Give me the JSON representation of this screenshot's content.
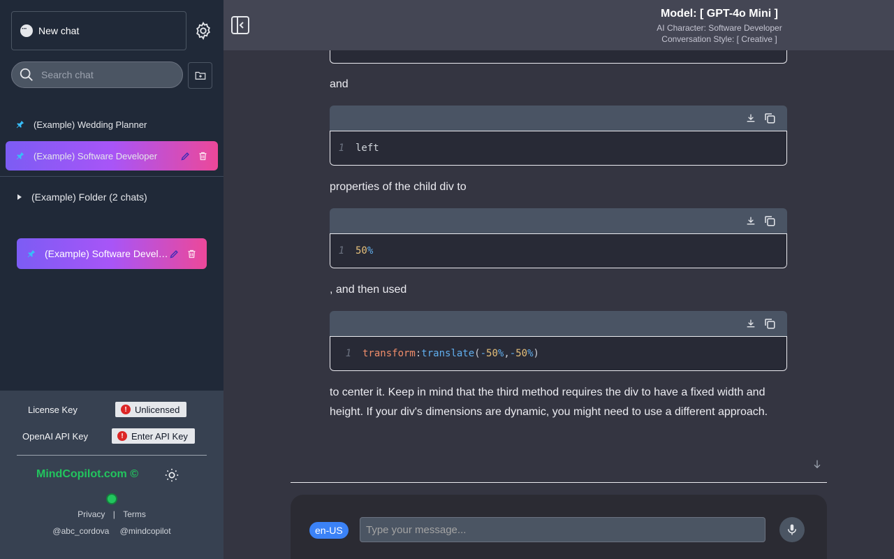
{
  "sidebar": {
    "new_chat_label": "New chat",
    "search_placeholder": "Search chat",
    "chats": [
      {
        "label": "(Example) Wedding Planner"
      },
      {
        "label": "(Example) Software Developer"
      }
    ],
    "folder": {
      "label": "(Example) Folder (2 chats)"
    },
    "folder_chat": {
      "label": "(Example) Software Developer"
    },
    "license_label": "License Key",
    "license_status": "Unlicensed",
    "api_label": "OpenAI API Key",
    "api_button": "Enter API Key",
    "brand": "MindCopilot.com ©",
    "privacy": "Privacy",
    "separator": "|",
    "terms": "Terms",
    "social_1": "@abc_cordova",
    "social_2": "@mindcopilot"
  },
  "header": {
    "model": "Model: [ GPT-4o Mini ]",
    "character": "AI Character: Software Developer",
    "style": "Conversation Style: [ Creative ]"
  },
  "content": {
    "para_and": "and",
    "para_properties": "properties of the child div to",
    "para_then": ", and then used",
    "para_final": "to center it. Keep in mind that the third method requires the div to have a fixed width and height. If your div's dimensions are dynamic, you might need to use a different approach.",
    "code_1": {
      "line": "1",
      "text": "left"
    },
    "code_2": {
      "line": "1",
      "num": "50",
      "pct": "%"
    },
    "code_3": {
      "line": "1",
      "prop": "transform",
      "colon": ": ",
      "fn": "translate",
      "open": "(",
      "neg1": "-",
      "n1": "50",
      "pct1": "%",
      "comma": ", ",
      "neg2": "-",
      "n2": "50",
      "pct2": "%",
      "close": ")"
    }
  },
  "composer": {
    "lang": "en-US",
    "placeholder": "Type your message..."
  },
  "colors": {
    "accent_gradient_start": "#7c5cf4",
    "accent_gradient_end": "#ec4899",
    "brand_green": "#22c55e",
    "lang_blue": "#3b82f6"
  },
  "icons": [
    "chat-bubble-icon",
    "gear-icon",
    "search-icon",
    "new-folder-icon",
    "pin-icon",
    "edit-icon",
    "trash-icon",
    "chevron-right-icon",
    "alert-icon",
    "sun-icon",
    "sidebar-toggle-icon",
    "download-icon",
    "copy-icon",
    "arrow-down-icon",
    "microphone-icon"
  ]
}
